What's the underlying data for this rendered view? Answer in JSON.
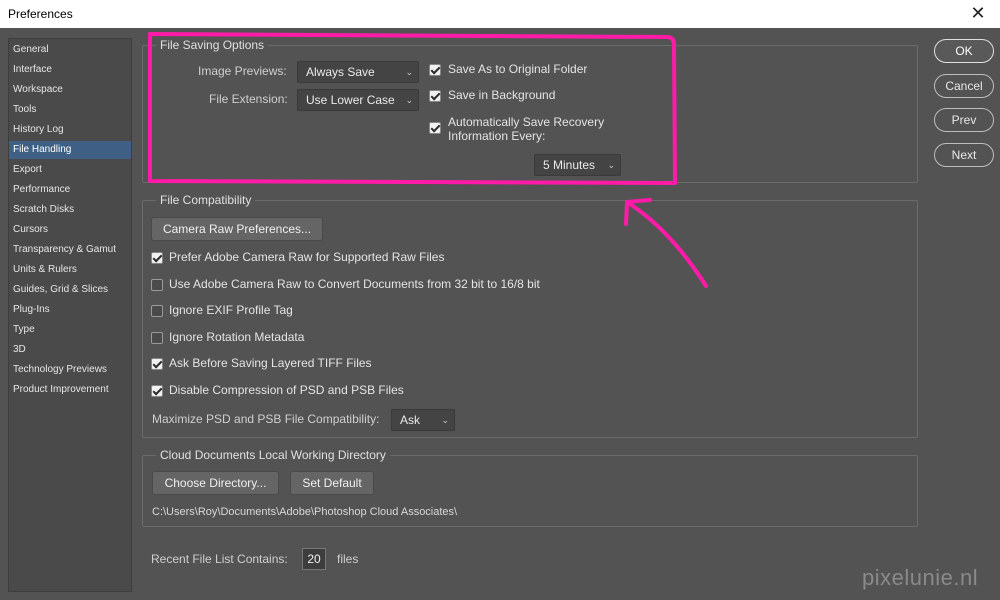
{
  "window": {
    "title": "Preferences",
    "close_icon": "close-icon"
  },
  "sidebar": {
    "items": [
      {
        "label": "General"
      },
      {
        "label": "Interface"
      },
      {
        "label": "Workspace"
      },
      {
        "label": "Tools"
      },
      {
        "label": "History Log"
      },
      {
        "label": "File Handling",
        "active": true
      },
      {
        "label": "Export"
      },
      {
        "label": "Performance"
      },
      {
        "label": "Scratch Disks"
      },
      {
        "label": "Cursors"
      },
      {
        "label": "Transparency & Gamut"
      },
      {
        "label": "Units & Rulers"
      },
      {
        "label": "Guides, Grid & Slices"
      },
      {
        "label": "Plug-Ins"
      },
      {
        "label": "Type"
      },
      {
        "label": "3D"
      },
      {
        "label": "Technology Previews"
      },
      {
        "label": "Product Improvement"
      }
    ]
  },
  "file_saving": {
    "title": "File Saving Options",
    "image_previews_label": "Image Previews:",
    "image_previews_value": "Always Save",
    "file_extension_label": "File Extension:",
    "file_extension_value": "Use Lower Case",
    "save_as_original": {
      "label": "Save As to Original Folder",
      "checked": true
    },
    "save_background": {
      "label": "Save in Background",
      "checked": true
    },
    "auto_recovery": {
      "label_line1": "Automatically Save Recovery",
      "label_line2": "Information Every:",
      "checked": true
    },
    "interval_value": "5 Minutes"
  },
  "file_compat": {
    "title": "File Compatibility",
    "camera_raw_button": "Camera Raw Preferences...",
    "options": [
      {
        "label": "Prefer Adobe Camera Raw for Supported Raw Files",
        "checked": true
      },
      {
        "label": "Use Adobe Camera Raw to Convert Documents from 32 bit to 16/8 bit",
        "checked": false
      },
      {
        "label": "Ignore EXIF Profile Tag",
        "checked": false
      },
      {
        "label": "Ignore Rotation Metadata",
        "checked": false
      },
      {
        "label": "Ask Before Saving Layered TIFF Files",
        "checked": true
      },
      {
        "label": "Disable Compression of PSD and PSB Files",
        "checked": true
      }
    ],
    "maximize_label": "Maximize PSD and PSB File Compatibility:",
    "maximize_value": "Ask"
  },
  "cloud": {
    "title": "Cloud Documents Local Working Directory",
    "choose_button": "Choose Directory...",
    "default_button": "Set Default",
    "path": "C:\\Users\\Roy\\Documents\\Adobe\\Photoshop Cloud Associates\\"
  },
  "recent": {
    "label": "Recent File List Contains:",
    "value": "20",
    "unit": "files"
  },
  "actions": {
    "ok": "OK",
    "cancel": "Cancel",
    "prev": "Prev",
    "next": "Next"
  },
  "watermark": "pixelunie.nl",
  "annotation_color": "#ff1aa8"
}
